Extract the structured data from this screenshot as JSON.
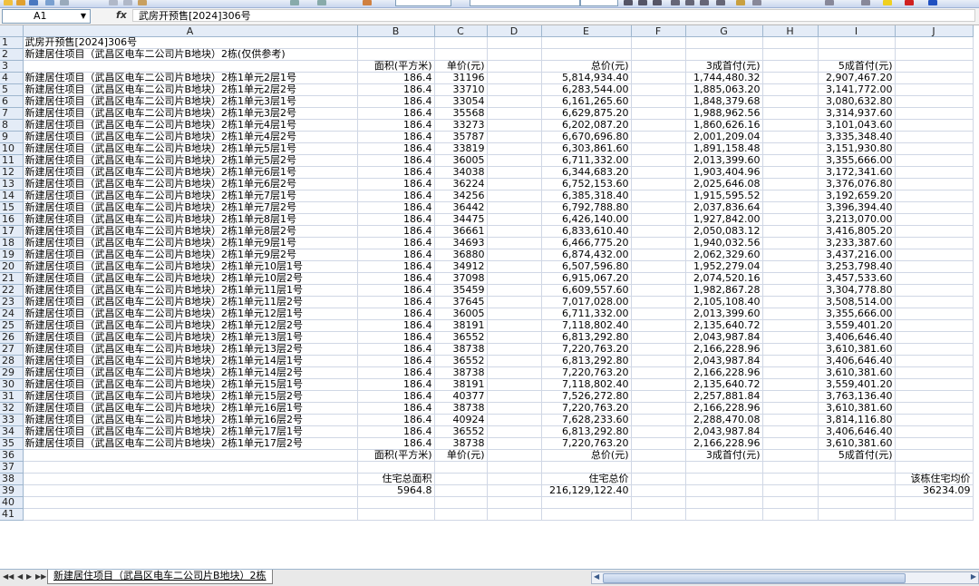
{
  "namebox": {
    "ref": "A1"
  },
  "formula": {
    "fx": "fx",
    "content": "武房开预售[2024]306号"
  },
  "columns": [
    "A",
    "B",
    "C",
    "D",
    "E",
    "F",
    "G",
    "H",
    "I",
    "J"
  ],
  "rows": [
    {
      "n": "1",
      "a": "武房开预售[2024]306号",
      "b": "",
      "c": "",
      "e": "",
      "g": "",
      "i": "",
      "j": ""
    },
    {
      "n": "2",
      "a": "新建居住项目（武昌区电车二公司片B地块）2栋(仅供参考)",
      "b": "",
      "c": "",
      "e": "",
      "g": "",
      "i": "",
      "j": ""
    },
    {
      "n": "3",
      "a": "",
      "b": "面积(平方米)",
      "c": "单价(元)",
      "e": "总价(元)",
      "g": "3成首付(元)",
      "i": "5成首付(元)",
      "j": ""
    },
    {
      "n": "4",
      "a": "新建居住项目（武昌区电车二公司片B地块）2栋1单元2层1号",
      "b": "186.4",
      "c": "31196",
      "e": "5,814,934.40",
      "g": "1,744,480.32",
      "i": "2,907,467.20",
      "j": ""
    },
    {
      "n": "5",
      "a": "新建居住项目（武昌区电车二公司片B地块）2栋1单元2层2号",
      "b": "186.4",
      "c": "33710",
      "e": "6,283,544.00",
      "g": "1,885,063.20",
      "i": "3,141,772.00",
      "j": ""
    },
    {
      "n": "6",
      "a": "新建居住项目（武昌区电车二公司片B地块）2栋1单元3层1号",
      "b": "186.4",
      "c": "33054",
      "e": "6,161,265.60",
      "g": "1,848,379.68",
      "i": "3,080,632.80",
      "j": ""
    },
    {
      "n": "7",
      "a": "新建居住项目（武昌区电车二公司片B地块）2栋1单元3层2号",
      "b": "186.4",
      "c": "35568",
      "e": "6,629,875.20",
      "g": "1,988,962.56",
      "i": "3,314,937.60",
      "j": ""
    },
    {
      "n": "8",
      "a": "新建居住项目（武昌区电车二公司片B地块）2栋1单元4层1号",
      "b": "186.4",
      "c": "33273",
      "e": "6,202,087.20",
      "g": "1,860,626.16",
      "i": "3,101,043.60",
      "j": ""
    },
    {
      "n": "9",
      "a": "新建居住项目（武昌区电车二公司片B地块）2栋1单元4层2号",
      "b": "186.4",
      "c": "35787",
      "e": "6,670,696.80",
      "g": "2,001,209.04",
      "i": "3,335,348.40",
      "j": ""
    },
    {
      "n": "10",
      "a": "新建居住项目（武昌区电车二公司片B地块）2栋1单元5层1号",
      "b": "186.4",
      "c": "33819",
      "e": "6,303,861.60",
      "g": "1,891,158.48",
      "i": "3,151,930.80",
      "j": ""
    },
    {
      "n": "11",
      "a": "新建居住项目（武昌区电车二公司片B地块）2栋1单元5层2号",
      "b": "186.4",
      "c": "36005",
      "e": "6,711,332.00",
      "g": "2,013,399.60",
      "i": "3,355,666.00",
      "j": ""
    },
    {
      "n": "12",
      "a": "新建居住项目（武昌区电车二公司片B地块）2栋1单元6层1号",
      "b": "186.4",
      "c": "34038",
      "e": "6,344,683.20",
      "g": "1,903,404.96",
      "i": "3,172,341.60",
      "j": ""
    },
    {
      "n": "13",
      "a": "新建居住项目（武昌区电车二公司片B地块）2栋1单元6层2号",
      "b": "186.4",
      "c": "36224",
      "e": "6,752,153.60",
      "g": "2,025,646.08",
      "i": "3,376,076.80",
      "j": ""
    },
    {
      "n": "14",
      "a": "新建居住项目（武昌区电车二公司片B地块）2栋1单元7层1号",
      "b": "186.4",
      "c": "34256",
      "e": "6,385,318.40",
      "g": "1,915,595.52",
      "i": "3,192,659.20",
      "j": ""
    },
    {
      "n": "15",
      "a": "新建居住项目（武昌区电车二公司片B地块）2栋1单元7层2号",
      "b": "186.4",
      "c": "36442",
      "e": "6,792,788.80",
      "g": "2,037,836.64",
      "i": "3,396,394.40",
      "j": ""
    },
    {
      "n": "16",
      "a": "新建居住项目（武昌区电车二公司片B地块）2栋1单元8层1号",
      "b": "186.4",
      "c": "34475",
      "e": "6,426,140.00",
      "g": "1,927,842.00",
      "i": "3,213,070.00",
      "j": ""
    },
    {
      "n": "17",
      "a": "新建居住项目（武昌区电车二公司片B地块）2栋1单元8层2号",
      "b": "186.4",
      "c": "36661",
      "e": "6,833,610.40",
      "g": "2,050,083.12",
      "i": "3,416,805.20",
      "j": ""
    },
    {
      "n": "18",
      "a": "新建居住项目（武昌区电车二公司片B地块）2栋1单元9层1号",
      "b": "186.4",
      "c": "34693",
      "e": "6,466,775.20",
      "g": "1,940,032.56",
      "i": "3,233,387.60",
      "j": ""
    },
    {
      "n": "19",
      "a": "新建居住项目（武昌区电车二公司片B地块）2栋1单元9层2号",
      "b": "186.4",
      "c": "36880",
      "e": "6,874,432.00",
      "g": "2,062,329.60",
      "i": "3,437,216.00",
      "j": ""
    },
    {
      "n": "20",
      "a": "新建居住项目（武昌区电车二公司片B地块）2栋1单元10层1号",
      "b": "186.4",
      "c": "34912",
      "e": "6,507,596.80",
      "g": "1,952,279.04",
      "i": "3,253,798.40",
      "j": ""
    },
    {
      "n": "21",
      "a": "新建居住项目（武昌区电车二公司片B地块）2栋1单元10层2号",
      "b": "186.4",
      "c": "37098",
      "e": "6,915,067.20",
      "g": "2,074,520.16",
      "i": "3,457,533.60",
      "j": ""
    },
    {
      "n": "22",
      "a": "新建居住项目（武昌区电车二公司片B地块）2栋1单元11层1号",
      "b": "186.4",
      "c": "35459",
      "e": "6,609,557.60",
      "g": "1,982,867.28",
      "i": "3,304,778.80",
      "j": ""
    },
    {
      "n": "23",
      "a": "新建居住项目（武昌区电车二公司片B地块）2栋1单元11层2号",
      "b": "186.4",
      "c": "37645",
      "e": "7,017,028.00",
      "g": "2,105,108.40",
      "i": "3,508,514.00",
      "j": ""
    },
    {
      "n": "24",
      "a": "新建居住项目（武昌区电车二公司片B地块）2栋1单元12层1号",
      "b": "186.4",
      "c": "36005",
      "e": "6,711,332.00",
      "g": "2,013,399.60",
      "i": "3,355,666.00",
      "j": ""
    },
    {
      "n": "25",
      "a": "新建居住项目（武昌区电车二公司片B地块）2栋1单元12层2号",
      "b": "186.4",
      "c": "38191",
      "e": "7,118,802.40",
      "g": "2,135,640.72",
      "i": "3,559,401.20",
      "j": ""
    },
    {
      "n": "26",
      "a": "新建居住项目（武昌区电车二公司片B地块）2栋1单元13层1号",
      "b": "186.4",
      "c": "36552",
      "e": "6,813,292.80",
      "g": "2,043,987.84",
      "i": "3,406,646.40",
      "j": ""
    },
    {
      "n": "27",
      "a": "新建居住项目（武昌区电车二公司片B地块）2栋1单元13层2号",
      "b": "186.4",
      "c": "38738",
      "e": "7,220,763.20",
      "g": "2,166,228.96",
      "i": "3,610,381.60",
      "j": ""
    },
    {
      "n": "28",
      "a": "新建居住项目（武昌区电车二公司片B地块）2栋1单元14层1号",
      "b": "186.4",
      "c": "36552",
      "e": "6,813,292.80",
      "g": "2,043,987.84",
      "i": "3,406,646.40",
      "j": ""
    },
    {
      "n": "29",
      "a": "新建居住项目（武昌区电车二公司片B地块）2栋1单元14层2号",
      "b": "186.4",
      "c": "38738",
      "e": "7,220,763.20",
      "g": "2,166,228.96",
      "i": "3,610,381.60",
      "j": ""
    },
    {
      "n": "30",
      "a": "新建居住项目（武昌区电车二公司片B地块）2栋1单元15层1号",
      "b": "186.4",
      "c": "38191",
      "e": "7,118,802.40",
      "g": "2,135,640.72",
      "i": "3,559,401.20",
      "j": ""
    },
    {
      "n": "31",
      "a": "新建居住项目（武昌区电车二公司片B地块）2栋1单元15层2号",
      "b": "186.4",
      "c": "40377",
      "e": "7,526,272.80",
      "g": "2,257,881.84",
      "i": "3,763,136.40",
      "j": ""
    },
    {
      "n": "32",
      "a": "新建居住项目（武昌区电车二公司片B地块）2栋1单元16层1号",
      "b": "186.4",
      "c": "38738",
      "e": "7,220,763.20",
      "g": "2,166,228.96",
      "i": "3,610,381.60",
      "j": ""
    },
    {
      "n": "33",
      "a": "新建居住项目（武昌区电车二公司片B地块）2栋1单元16层2号",
      "b": "186.4",
      "c": "40924",
      "e": "7,628,233.60",
      "g": "2,288,470.08",
      "i": "3,814,116.80",
      "j": ""
    },
    {
      "n": "34",
      "a": "新建居住项目（武昌区电车二公司片B地块）2栋1单元17层1号",
      "b": "186.4",
      "c": "36552",
      "e": "6,813,292.80",
      "g": "2,043,987.84",
      "i": "3,406,646.40",
      "j": ""
    },
    {
      "n": "35",
      "a": "新建居住项目（武昌区电车二公司片B地块）2栋1单元17层2号",
      "b": "186.4",
      "c": "38738",
      "e": "7,220,763.20",
      "g": "2,166,228.96",
      "i": "3,610,381.60",
      "j": ""
    },
    {
      "n": "36",
      "a": "",
      "b": "面积(平方米)",
      "c": "单价(元)",
      "e": "总价(元)",
      "g": "3成首付(元)",
      "i": "5成首付(元)",
      "j": ""
    },
    {
      "n": "37",
      "a": "",
      "b": "",
      "c": "",
      "e": "",
      "g": "",
      "i": "",
      "j": ""
    },
    {
      "n": "38",
      "a": "",
      "b": "住宅总面积",
      "c": "",
      "e": "住宅总价",
      "g": "",
      "i": "",
      "j": "该栋住宅均价"
    },
    {
      "n": "39",
      "a": "",
      "b": "5964.8",
      "c": "",
      "e": "216,129,122.40",
      "g": "",
      "i": "",
      "j": "36234.09"
    },
    {
      "n": "40",
      "a": "",
      "b": "",
      "c": "",
      "e": "",
      "g": "",
      "i": "",
      "j": ""
    },
    {
      "n": "41",
      "a": "",
      "b": "",
      "c": "",
      "e": "",
      "g": "",
      "i": "",
      "j": ""
    }
  ],
  "sheet_tab": "新建居住项目（武昌区电车二公司片B地块）2栋",
  "nav": {
    "first": "◀◀",
    "prev": "◀",
    "next": "▶",
    "last": "▶▶"
  }
}
